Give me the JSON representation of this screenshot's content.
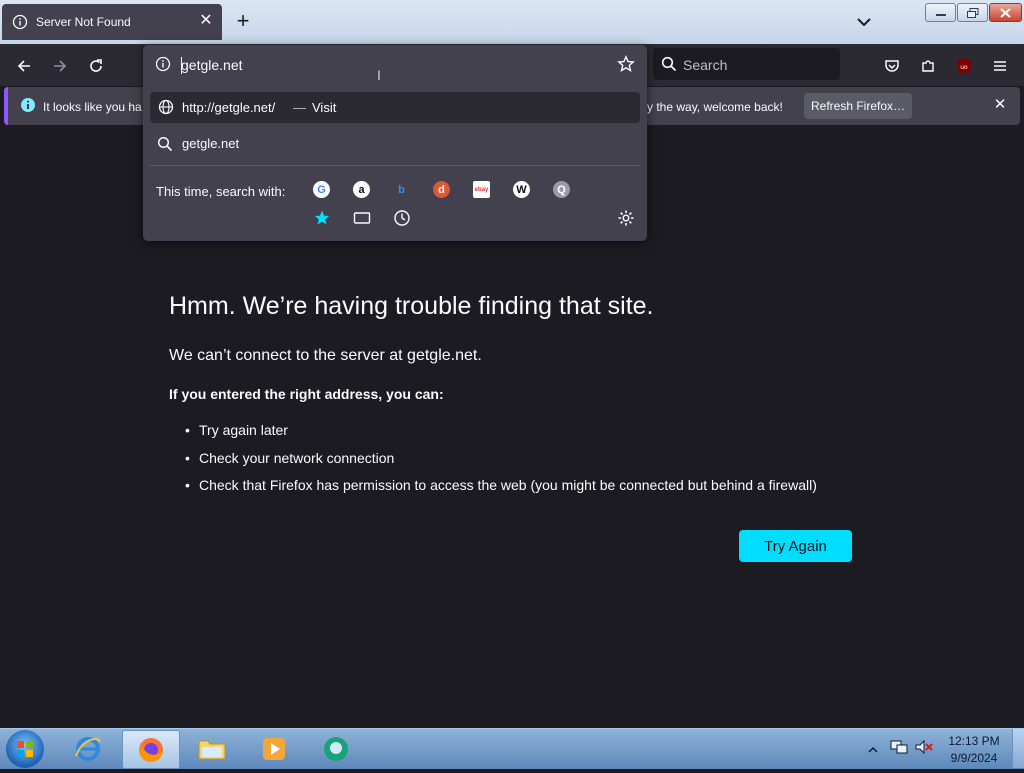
{
  "tab": {
    "title": "Server Not Found",
    "close": "✕",
    "new_tab": "+"
  },
  "toolbar": {
    "search_placeholder": "Search"
  },
  "urlbar": {
    "value": "getgle.net",
    "suggestions": [
      {
        "text": "http://getgle.net/",
        "separator": "—",
        "action": "Visit",
        "icon": "globe-icon"
      },
      {
        "text": "getgle.net",
        "icon": "search-icon"
      }
    ],
    "oneoff_label": "This time, search with:",
    "engines": [
      {
        "name": "google-engine",
        "glyph": "G",
        "bg": "#ffffff",
        "fg": "#4285f4"
      },
      {
        "name": "amazon-engine",
        "glyph": "a",
        "bg": "#ffffff",
        "fg": "#111111"
      },
      {
        "name": "bing-engine",
        "glyph": "b",
        "bg": "transparent",
        "fg": "#2f8ff0"
      },
      {
        "name": "duckduckgo-engine",
        "glyph": "d",
        "bg": "#de5833",
        "fg": "#ffffff"
      },
      {
        "name": "ebay-engine",
        "glyph": "ebay",
        "bg": "#ffffff",
        "fg": "#e53238"
      },
      {
        "name": "wikipedia-engine",
        "glyph": "W",
        "bg": "#ffffff",
        "fg": "#111111"
      },
      {
        "name": "other-search-engine",
        "glyph": "Q",
        "bg": "#9b9ba5",
        "fg": "#ffffff"
      }
    ]
  },
  "notification": {
    "text_left": "It looks like you ha",
    "text_right": "y the way, welcome back!",
    "button": "Refresh Firefox…",
    "close": "✕"
  },
  "error": {
    "title": "Hmm. We’re having trouble finding that site.",
    "subtitle": "We can’t connect to the server at getgle.net.",
    "heading": "If you entered the right address, you can:",
    "items": [
      "Try again later",
      "Check your network connection",
      "Check that Firefox has permission to access the web (you might be connected but behind a firewall)"
    ],
    "button": "Try Again"
  },
  "taskbar": {
    "time": "12:13 PM",
    "date": "9/9/2024"
  },
  "colors": {
    "accent": "#00ddff",
    "page_bg": "#1c1b22",
    "panel_bg": "#42414d"
  }
}
